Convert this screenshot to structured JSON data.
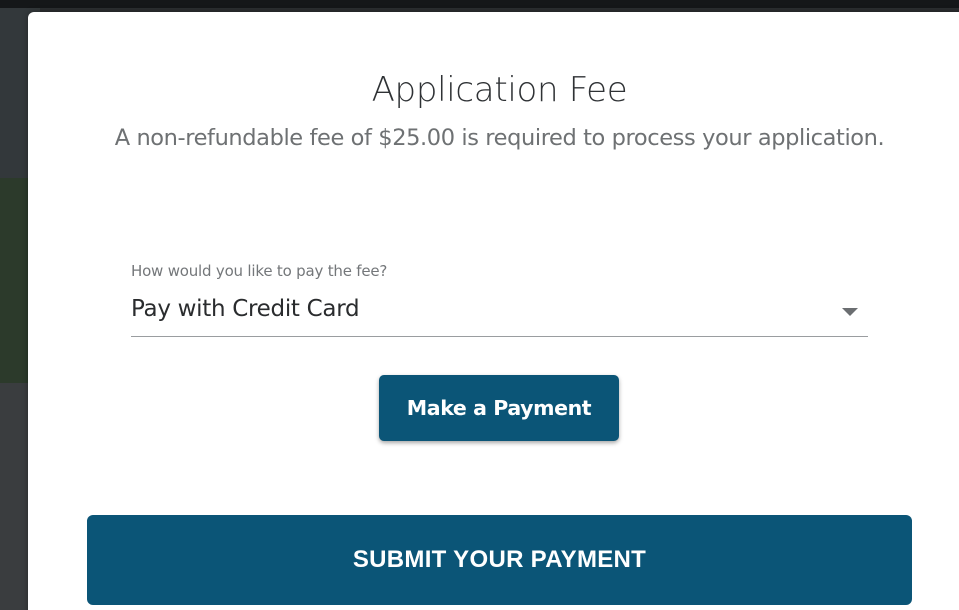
{
  "modal": {
    "title": "Application Fee",
    "subtitle": "A non-refundable fee of $25.00 is required to process your application."
  },
  "payment_method": {
    "label": "How would you like to pay the fee?",
    "selected": "Pay with Credit Card"
  },
  "buttons": {
    "make_payment": "Make a Payment",
    "submit_payment": "SUBMIT YOUR PAYMENT"
  },
  "colors": {
    "primary": "#0b5577",
    "overlay": "#2b2e30"
  }
}
